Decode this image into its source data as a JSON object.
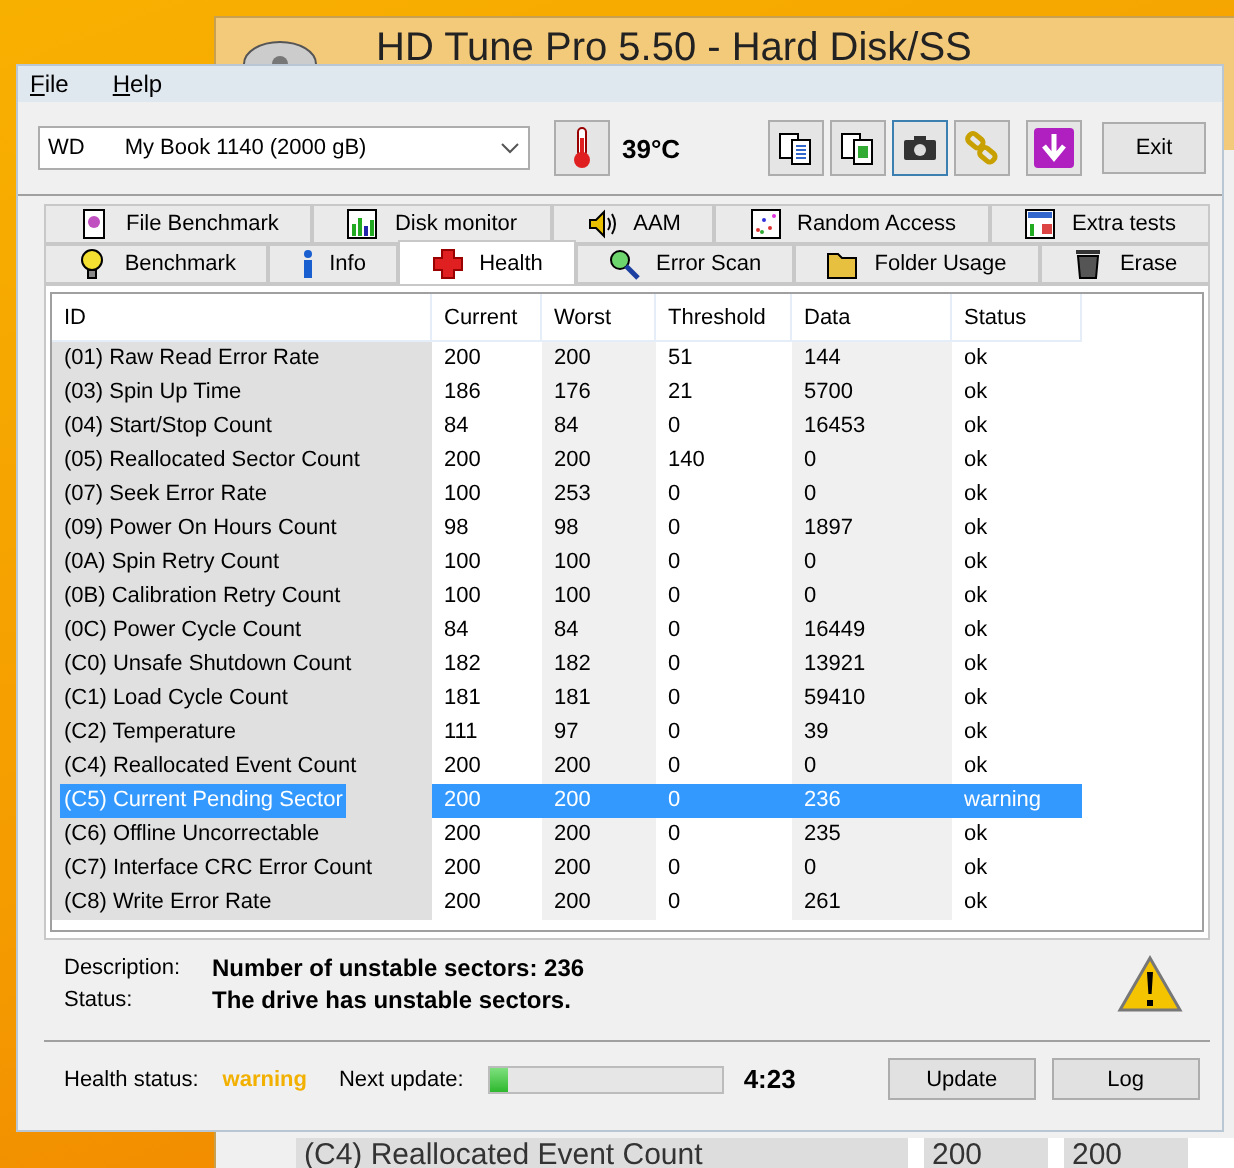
{
  "background_window": {
    "title": "HD Tune Pro 5.50 - Hard Disk/SS",
    "row": [
      "(C4) Reallocated Event Count",
      "200",
      "200"
    ]
  },
  "menu": [
    {
      "label": "File"
    },
    {
      "label": "Help"
    }
  ],
  "drive": {
    "vendor": "WD",
    "model": "My Book 1140 (2000 gB)"
  },
  "temperature": "39°C",
  "toolbar": [
    {
      "kind": "copy-text",
      "selected": false
    },
    {
      "kind": "copy-image",
      "selected": false
    },
    {
      "kind": "camera",
      "selected": true
    },
    {
      "kind": "chain",
      "selected": false
    },
    {
      "kind": "download",
      "selected": false
    }
  ],
  "exit_button": "Exit",
  "tab_rows": [
    {
      "tabs": [
        {
          "label": "File Benchmark",
          "kind": "file",
          "selected": false
        },
        {
          "label": "Disk monitor",
          "kind": "monitor",
          "selected": false
        },
        {
          "label": "AAM",
          "kind": "speaker",
          "selected": false
        },
        {
          "label": "Random Access",
          "kind": "scatter",
          "selected": false
        },
        {
          "label": "Extra tests",
          "kind": "grid",
          "selected": false
        }
      ]
    },
    {
      "tabs": [
        {
          "label": "Benchmark",
          "kind": "bulb",
          "selected": false
        },
        {
          "label": "Info",
          "kind": "info",
          "selected": false
        },
        {
          "label": "Health",
          "kind": "cross",
          "selected": true
        },
        {
          "label": "Error Scan",
          "kind": "magnifier",
          "selected": false
        },
        {
          "label": "Folder Usage",
          "kind": "folder",
          "selected": false
        },
        {
          "label": "Erase",
          "kind": "trash",
          "selected": false
        }
      ]
    }
  ],
  "table": {
    "columns": [
      "ID",
      "Current",
      "Worst",
      "Threshold",
      "Data",
      "Status"
    ],
    "rows": [
      {
        "cells": [
          "(01) Raw Read Error Rate",
          "200",
          "200",
          "51",
          "144",
          "ok"
        ],
        "selected": false
      },
      {
        "cells": [
          "(03) Spin Up Time",
          "186",
          "176",
          "21",
          "5700",
          "ok"
        ],
        "selected": false
      },
      {
        "cells": [
          "(04) Start/Stop Count",
          "84",
          "84",
          "0",
          "16453",
          "ok"
        ],
        "selected": false
      },
      {
        "cells": [
          "(05) Reallocated Sector Count",
          "200",
          "200",
          "140",
          "0",
          "ok"
        ],
        "selected": false
      },
      {
        "cells": [
          "(07) Seek Error Rate",
          "100",
          "253",
          "0",
          "0",
          "ok"
        ],
        "selected": false
      },
      {
        "cells": [
          "(09) Power On Hours Count",
          "98",
          "98",
          "0",
          "1897",
          "ok"
        ],
        "selected": false
      },
      {
        "cells": [
          "(0A) Spin Retry Count",
          "100",
          "100",
          "0",
          "0",
          "ok"
        ],
        "selected": false
      },
      {
        "cells": [
          "(0B) Calibration Retry Count",
          "100",
          "100",
          "0",
          "0",
          "ok"
        ],
        "selected": false
      },
      {
        "cells": [
          "(0C) Power Cycle Count",
          "84",
          "84",
          "0",
          "16449",
          "ok"
        ],
        "selected": false
      },
      {
        "cells": [
          "(C0) Unsafe Shutdown Count",
          "182",
          "182",
          "0",
          "13921",
          "ok"
        ],
        "selected": false
      },
      {
        "cells": [
          "(C1) Load Cycle Count",
          "181",
          "181",
          "0",
          "59410",
          "ok"
        ],
        "selected": false
      },
      {
        "cells": [
          "(C2) Temperature",
          "111",
          "97",
          "0",
          "39",
          "ok"
        ],
        "selected": false
      },
      {
        "cells": [
          "(C4) Reallocated Event Count",
          "200",
          "200",
          "0",
          "0",
          "ok"
        ],
        "selected": false
      },
      {
        "cells": [
          "(C5) Current Pending Sector",
          "200",
          "200",
          "0",
          "236",
          "warning"
        ],
        "selected": true
      },
      {
        "cells": [
          "(C6) Offline Uncorrectable",
          "200",
          "200",
          "0",
          "235",
          "ok"
        ],
        "selected": false
      },
      {
        "cells": [
          "(C7) Interface CRC Error Count",
          "200",
          "200",
          "0",
          "0",
          "ok"
        ],
        "selected": false
      },
      {
        "cells": [
          "(C8) Write Error Rate",
          "200",
          "200",
          "0",
          "261",
          "ok"
        ],
        "selected": false
      }
    ]
  },
  "description": {
    "label": "Description:",
    "value": "Number of unstable sectors: 236"
  },
  "status": {
    "label": "Status:",
    "value": "The drive has unstable sectors."
  },
  "health": {
    "label": "Health status:",
    "value": "warning"
  },
  "next_update": {
    "label": "Next update:",
    "level": 0.08,
    "time": "4:23"
  },
  "buttons": [
    "Update",
    "Log"
  ]
}
